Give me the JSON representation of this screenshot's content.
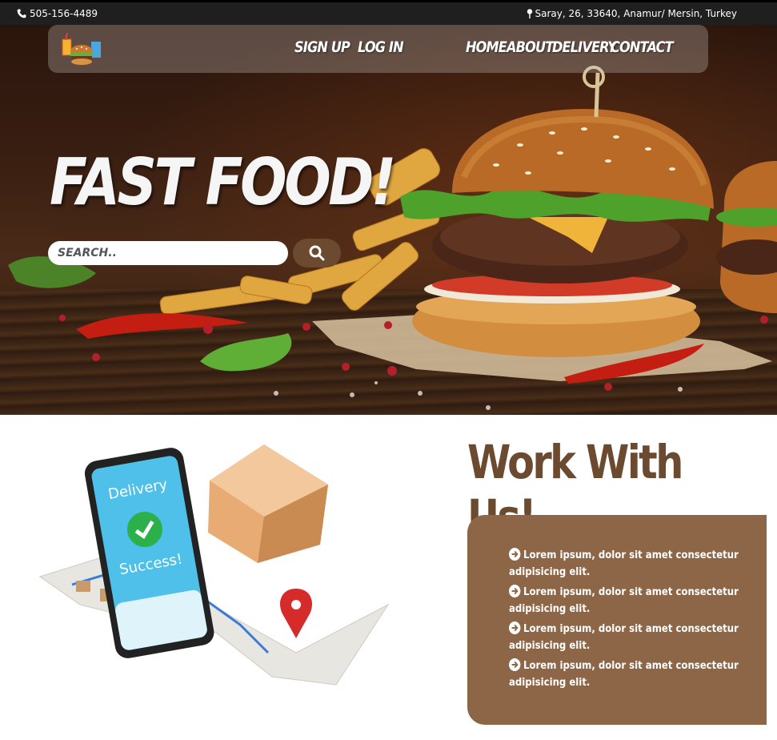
{
  "topbar": {
    "phone": "505-156-4489",
    "phone_icon": "phone-icon",
    "address": "Saray, 26, 33640, Anamur/ Mersin, Turkey",
    "address_icon": "map-pin-icon"
  },
  "nav": {
    "logo_icon": "fast-food-logo-icon",
    "links": [
      "SIGN UP",
      "LOG IN",
      "HOME",
      "ABOUT",
      "DELIVERY",
      "CONTACT"
    ]
  },
  "hero": {
    "title": "FAST FOOD!",
    "search_placeholder": "SEARCH..",
    "search_icon": "search-icon"
  },
  "work": {
    "title": "Work With Us!",
    "items": [
      "Lorem ipsum, dolor sit amet consectetur adipisicing elit.",
      "Lorem ipsum, dolor sit amet consectetur adipisicing elit.",
      "Lorem ipsum, dolor sit amet consectetur adipisicing elit.",
      "Lorem ipsum, dolor sit amet consectetur adipisicing elit."
    ],
    "item_icon": "arrow-circle-right-icon"
  },
  "illustration": {
    "phone_text_1": "Delivery",
    "phone_text_2": "Success!"
  },
  "colors": {
    "topbar_bg": "#1f1f1f",
    "accent_brown": "#6b4a2f",
    "box_brown": "#8c6647"
  }
}
